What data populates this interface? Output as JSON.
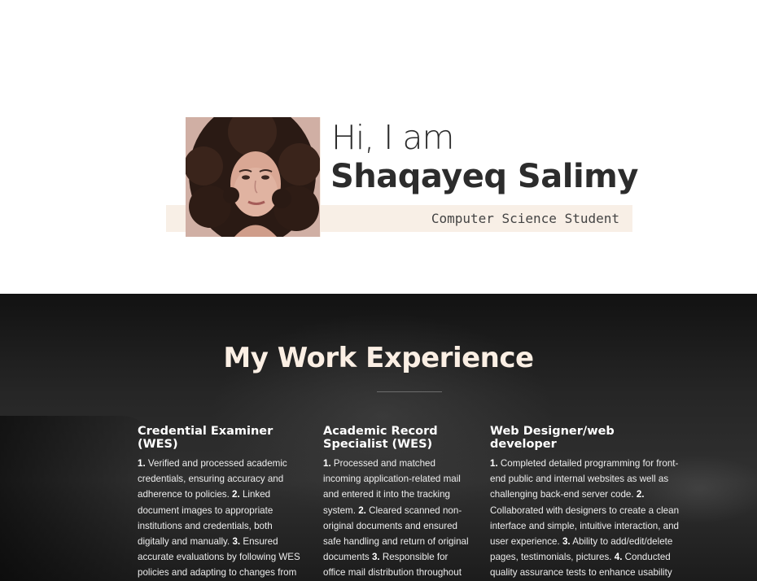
{
  "hero": {
    "greeting": "Hi, I am",
    "name": "Shaqayeq Salimy",
    "subtitle": "Computer Science Student",
    "photo_alt": "Profile photo of Shaqayeq Salimy"
  },
  "experience": {
    "title": "My Work Experience",
    "jobs": [
      {
        "title": "Credential Examiner (WES)",
        "items": [
          {
            "num": "1.",
            "text": "Verified and processed academic credentials, ensuring accuracy and adherence to policies."
          },
          {
            "num": "2.",
            "text": "Linked document images to appropriate institutions and credentials, both digitally and manually."
          },
          {
            "num": "3.",
            "text": "Ensured accurate evaluations by following WES policies and adapting to changes from the Evaluation Governance Committee."
          }
        ]
      },
      {
        "title": "Academic Record Specialist (WES)",
        "items": [
          {
            "num": "1.",
            "text": "Processed and matched incoming application-related mail and entered it into the tracking system."
          },
          {
            "num": "2.",
            "text": "Cleared scanned non-original documents and ensured safe handling and return of original documents"
          },
          {
            "num": "3.",
            "text": "Responsible for office mail distribution throughout departments"
          }
        ]
      },
      {
        "title": "Web Designer/web developer",
        "items": [
          {
            "num": "1.",
            "text": "Completed detailed programming for front-end public and internal websites as well as challenging back-end server code."
          },
          {
            "num": "2.",
            "text": "Collaborated with designers to create a clean interface and simple, intuitive interaction, and user experience."
          },
          {
            "num": "3.",
            "text": "Ability to add/edit/delete pages, testimonials, pictures."
          },
          {
            "num": "4.",
            "text": "Conducted quality assurance tests to enhance usability and functionality."
          }
        ]
      }
    ]
  },
  "colors": {
    "accent_band": "#f8efe6",
    "heading_cream": "#fbefe4",
    "text_dark": "#2c2c2c"
  }
}
